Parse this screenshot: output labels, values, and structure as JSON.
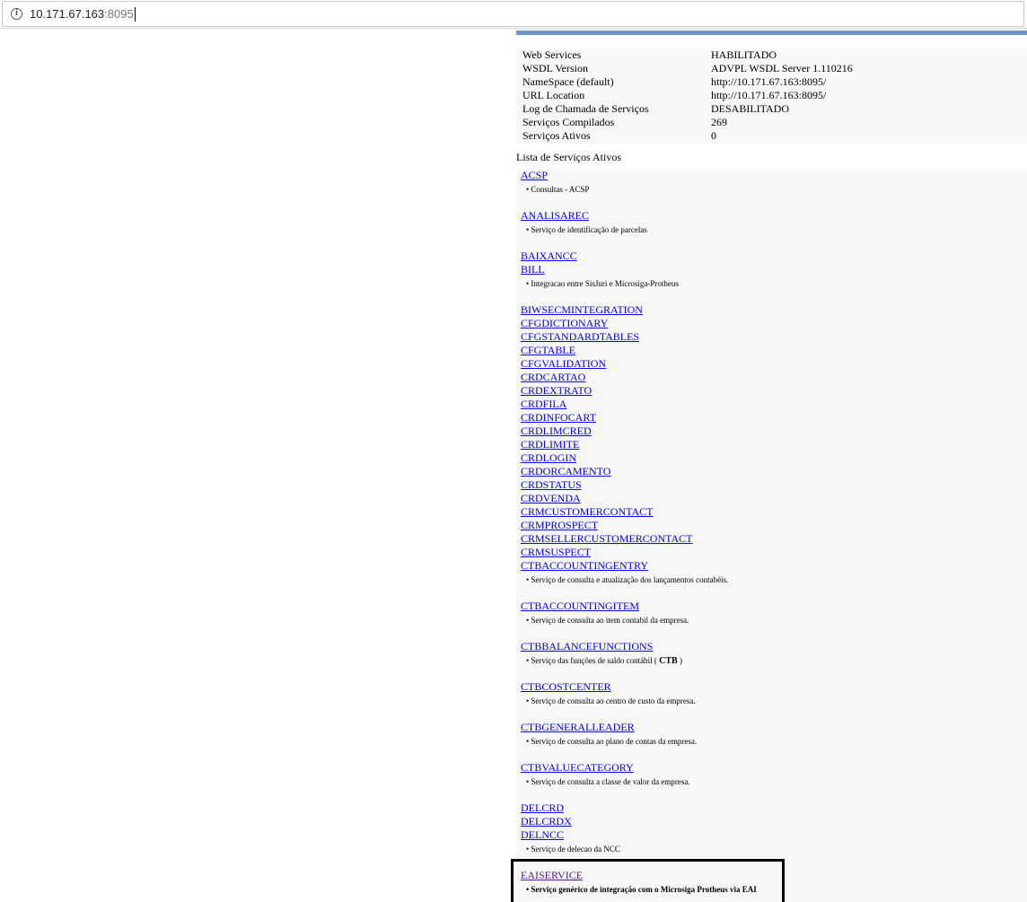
{
  "browser": {
    "url_host": "10.171.67.163",
    "url_port": ":8095"
  },
  "server_info": [
    {
      "label": "Web Services",
      "value": "HABILITADO"
    },
    {
      "label": "WSDL Version",
      "value": "ADVPL WSDL Server 1.110216"
    },
    {
      "label": "NameSpace (default)",
      "value": "http://10.171.67.163:8095/"
    },
    {
      "label": "URL Location",
      "value": "http://10.171.67.163:8095/"
    },
    {
      "label": "Log de Chamada de Serviços",
      "value": "DESABILITADO"
    },
    {
      "label": "Serviços Compilados",
      "value": "269"
    },
    {
      "label": "Serviços Ativos",
      "value": "0"
    }
  ],
  "services_list": {
    "title": "Lista de Serviços Ativos",
    "items": [
      {
        "name": "ACSP",
        "desc": "Consultas - ACSP"
      },
      {
        "name": "ANALISAREC",
        "desc": "Serviço de identificação de parcelas"
      },
      {
        "name": "BAIXANCC"
      },
      {
        "name": "BILL",
        "desc": "Integracao entre SisJuri e Microsiga-Protheus"
      },
      {
        "name": "BIWSECMINTEGRATION"
      },
      {
        "name": "CFGDICTIONARY"
      },
      {
        "name": "CFGSTANDARDTABLES"
      },
      {
        "name": "CFGTABLE"
      },
      {
        "name": "CFGVALIDATION"
      },
      {
        "name": "CRDCARTAO"
      },
      {
        "name": "CRDEXTRATO"
      },
      {
        "name": "CRDFILA"
      },
      {
        "name": "CRDINFOCART"
      },
      {
        "name": "CRDLIMCRED"
      },
      {
        "name": "CRDLIMITE"
      },
      {
        "name": "CRDLOGIN"
      },
      {
        "name": "CRDORCAMENTO"
      },
      {
        "name": "CRDSTATUS"
      },
      {
        "name": "CRDVENDA"
      },
      {
        "name": "CRMCUSTOMERCONTACT"
      },
      {
        "name": "CRMPROSPECT"
      },
      {
        "name": "CRMSELLERCUSTOMERCONTACT"
      },
      {
        "name": "CRMSUSPECT"
      },
      {
        "name": "CTBACCOUNTINGENTRY",
        "desc": "Serviço de consulta e atualização dos lançamentos contabéis."
      },
      {
        "name": "CTBACCOUNTINGITEM",
        "desc": "Serviço de consulta ao item contabil da empresa."
      },
      {
        "name": "CTBBALANCEFUNCTIONS",
        "desc": "Serviço das funções de saldo contábil (",
        "desc_bold": "CTB",
        "desc_after": ")"
      },
      {
        "name": "CTBCOSTCENTER",
        "desc": "Serviço de consulta ao centro de custo da empresa."
      },
      {
        "name": "CTBGENERALLEADER",
        "desc": "Serviço de consulta ao plano de contas da empresa."
      },
      {
        "name": "CTBVALUECATEGORY",
        "desc": "Serviço de consulta a classe de valor da empresa."
      },
      {
        "name": "DELCRD"
      },
      {
        "name": "DELCRDX"
      },
      {
        "name": "DELNCC",
        "desc": "Serviço de delecao da NCC"
      },
      {
        "name": "EAISERVICE",
        "desc": "Serviço genérico de integração com o Microsiga Protheus via EAI",
        "visited": true,
        "highlight": true
      }
    ]
  },
  "colors": {
    "link": "#0000ee",
    "visited_link": "#551a8b",
    "header_bar": "#6c97c7",
    "panel_bg": "#f7f7f7"
  }
}
